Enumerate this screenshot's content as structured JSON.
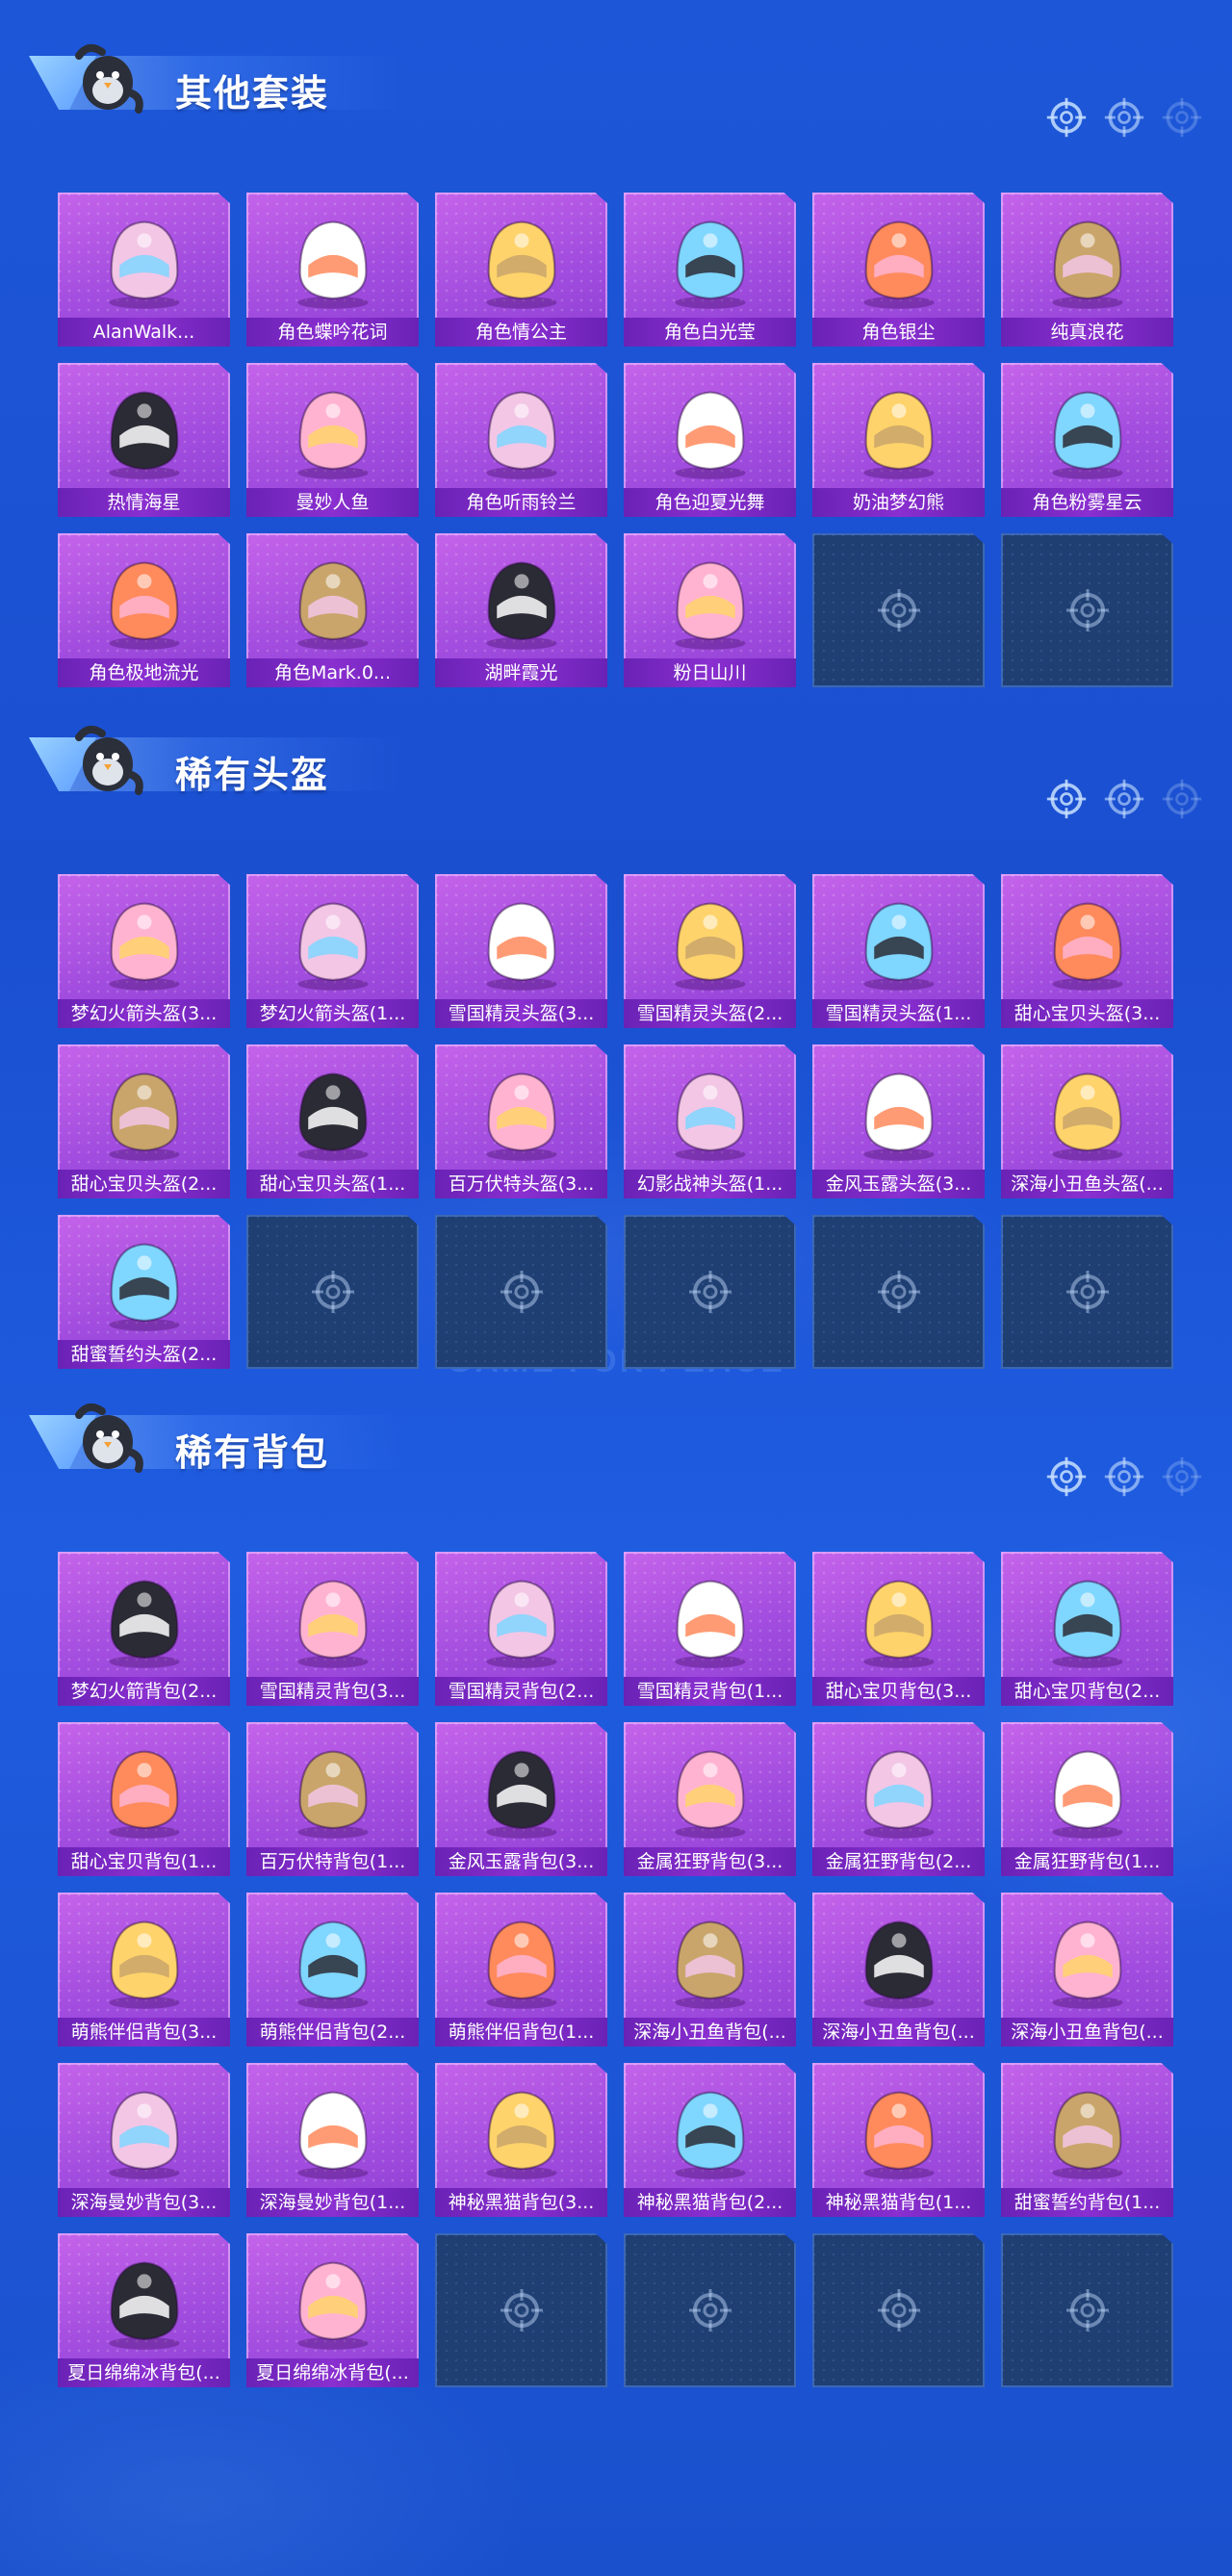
{
  "sections": [
    {
      "title": "其他套装",
      "items": [
        "AlanWalk...",
        "角色蝶吟花词",
        "角色情公主",
        "角色白光莹",
        "角色银尘",
        "纯真浪花",
        "热情海星",
        "曼妙人鱼",
        "角色听雨铃兰",
        "角色迎夏光舞",
        "奶油梦幻熊",
        "角色粉雾星云",
        "角色极地流光",
        "角色Mark.0...",
        "湖畔霞光",
        "粉日山川",
        "",
        ""
      ]
    },
    {
      "title": "稀有头盔",
      "items": [
        "梦幻火箭头盔(3...",
        "梦幻火箭头盔(1...",
        "雪国精灵头盔(3...",
        "雪国精灵头盔(2...",
        "雪国精灵头盔(1...",
        "甜心宝贝头盔(3...",
        "甜心宝贝头盔(2...",
        "甜心宝贝头盔(1...",
        "百万伏特头盔(3...",
        "幻影战神头盔(1...",
        "金风玉露头盔(3...",
        "深海小丑鱼头盔(...",
        "甜蜜誓约头盔(2...",
        "",
        "",
        "",
        "",
        ""
      ]
    },
    {
      "title": "稀有背包",
      "items": [
        "梦幻火箭背包(2...",
        "雪国精灵背包(3...",
        "雪国精灵背包(2...",
        "雪国精灵背包(1...",
        "甜心宝贝背包(3...",
        "甜心宝贝背包(2...",
        "甜心宝贝背包(1...",
        "百万伏特背包(1...",
        "金风玉露背包(3...",
        "金属狂野背包(3...",
        "金属狂野背包(2...",
        "金属狂野背包(1...",
        "萌熊伴侣背包(3...",
        "萌熊伴侣背包(2...",
        "萌熊伴侣背包(1...",
        "深海小丑鱼背包(...",
        "深海小丑鱼背包(...",
        "深海小丑鱼背包(...",
        "深海曼妙背包(3...",
        "深海曼妙背包(1...",
        "神秘黑猫背包(3...",
        "神秘黑猫背包(2...",
        "神秘黑猫背包(1...",
        "甜蜜誓约背包(1...",
        "夏日绵绵冰背包(...",
        "夏日绵绵冰背包(...",
        "",
        "",
        "",
        ""
      ]
    }
  ],
  "watermark": "GAME FOR PEACE",
  "colors": {
    "card": "#a24ddf",
    "label": "#7a28c4",
    "empty": "#1f3f73",
    "bg": "#1d57d8"
  }
}
